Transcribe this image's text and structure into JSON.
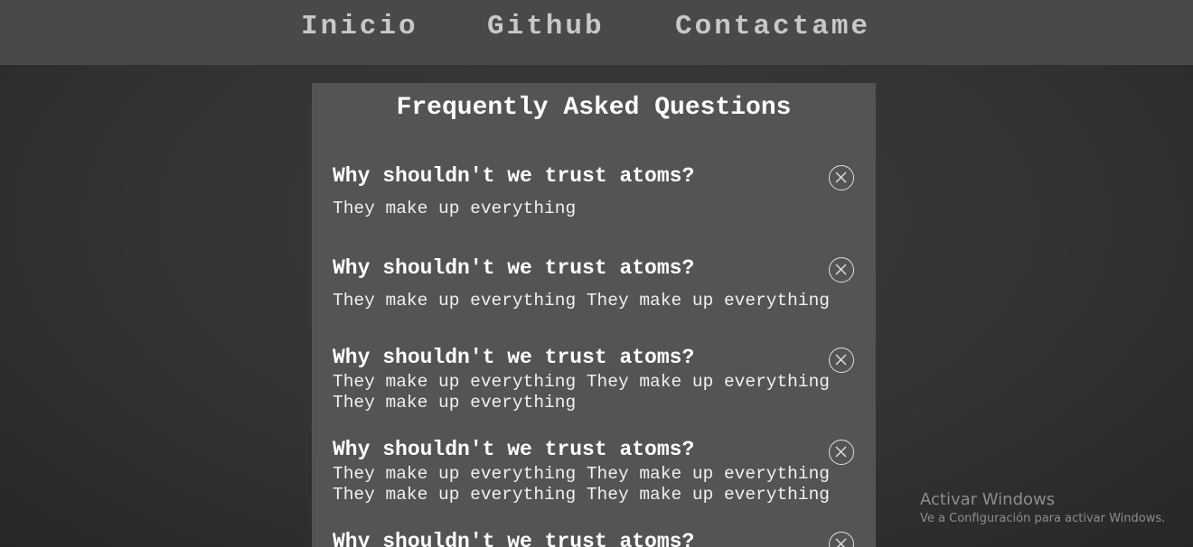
{
  "nav": {
    "items": [
      {
        "label": "Inicio"
      },
      {
        "label": "Github"
      },
      {
        "label": "Contactame"
      }
    ]
  },
  "faq": {
    "title": "Frequently Asked Questions",
    "items": [
      {
        "question": "Why shouldn't we trust atoms?",
        "answer": "They make up everything"
      },
      {
        "question": "Why shouldn't we trust atoms?",
        "answer": "They make up everything They make up everything"
      },
      {
        "question": "Why shouldn't we trust atoms?",
        "answer": "They make up everything They make up everything They make up everything"
      },
      {
        "question": "Why shouldn't we trust atoms?",
        "answer": "They make up everything They make up everything They make up everything They make up everything"
      },
      {
        "question": "Why shouldn't we trust atoms?",
        "answer": ""
      }
    ],
    "close_icon": "close-circle-icon"
  },
  "watermark": {
    "title": "Activar Windows",
    "subtitle": "Ve a Configuración para activar Windows."
  },
  "colors": {
    "navbar": "#494949",
    "background": "#333333",
    "panel": "#545454",
    "nav_text": "#c8c8c8",
    "text": "#ffffff"
  }
}
